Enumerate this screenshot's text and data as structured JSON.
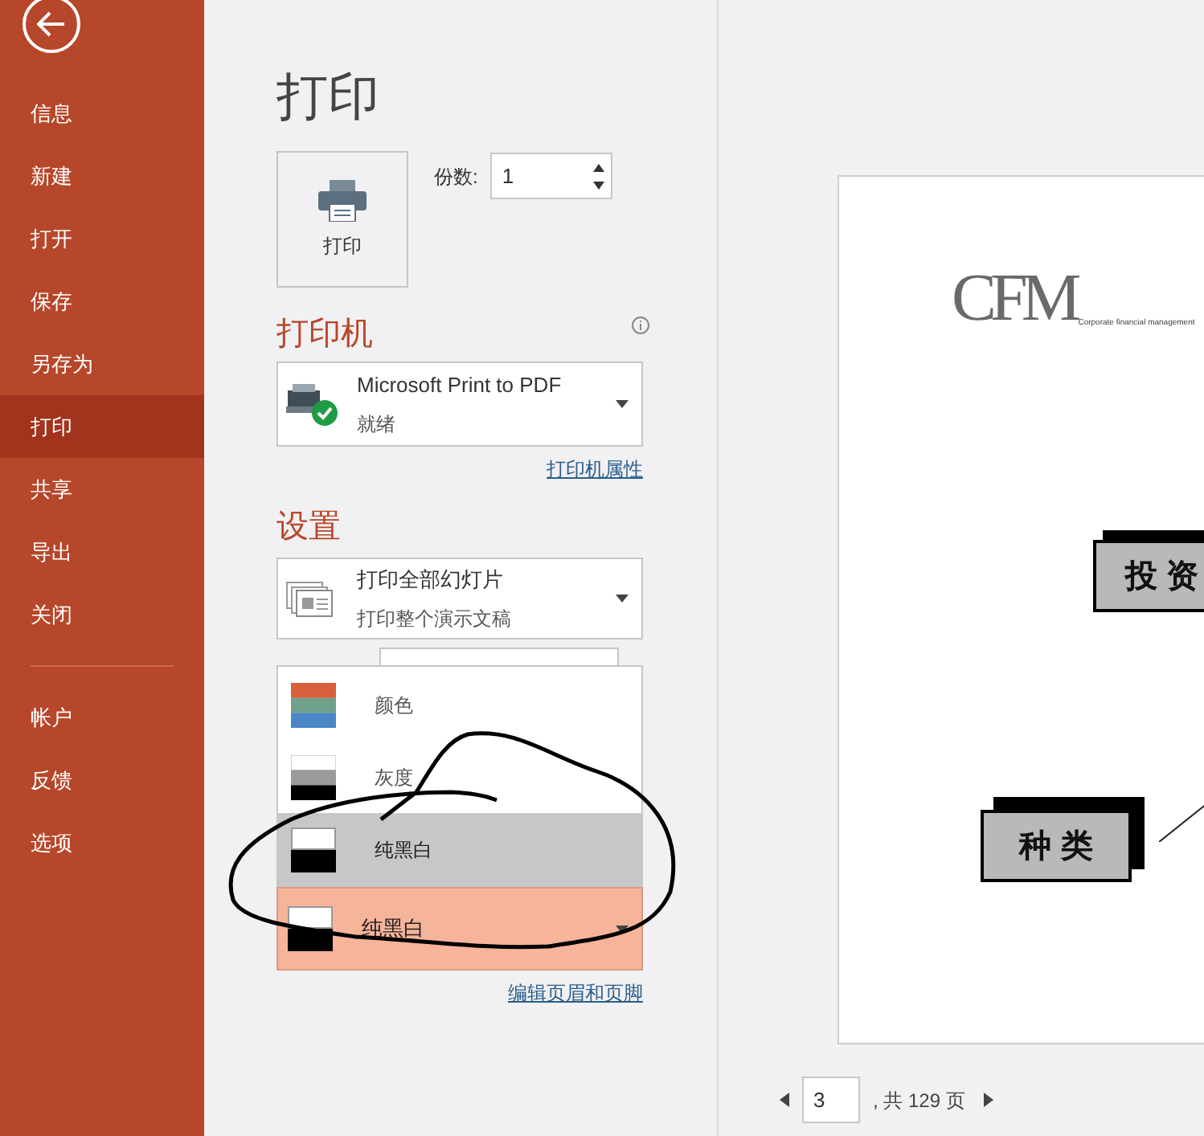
{
  "sidebar": {
    "items": [
      {
        "label": "信息",
        "selected": false
      },
      {
        "label": "新建",
        "selected": false
      },
      {
        "label": "打开",
        "selected": false
      },
      {
        "label": "保存",
        "selected": false
      },
      {
        "label": "另存为",
        "selected": false
      },
      {
        "label": "打印",
        "selected": true
      },
      {
        "label": "共享",
        "selected": false
      },
      {
        "label": "导出",
        "selected": false
      },
      {
        "label": "关闭",
        "selected": false
      }
    ],
    "bottom_items": [
      {
        "label": "帐户",
        "selected": false
      },
      {
        "label": "反馈",
        "selected": false
      },
      {
        "label": "选项",
        "selected": false
      }
    ]
  },
  "title": "打印",
  "print_button": {
    "label": "打印"
  },
  "copies": {
    "label": "份数:",
    "value": "1"
  },
  "printer": {
    "heading": "打印机",
    "name": "Microsoft Print to PDF",
    "status": "就绪",
    "link": "打印机属性"
  },
  "settings": {
    "heading": "设置",
    "slides": {
      "title": "打印全部幻灯片",
      "subtitle": "打印整个演示文稿"
    },
    "color_menu": [
      {
        "kind": "color",
        "label": "颜色",
        "selected": false
      },
      {
        "kind": "grayscale",
        "label": "灰度",
        "selected": false
      },
      {
        "kind": "blackwhite",
        "label": "纯黑白",
        "selected": true
      }
    ],
    "color": {
      "kind": "blackwhite",
      "label": "纯黑白"
    },
    "link": "编辑页眉和页脚"
  },
  "preview": {
    "logo": "CFM",
    "tagline": "Corporate financial management",
    "boxes": [
      "投 资",
      "种 类"
    ]
  },
  "pager": {
    "page": "3",
    "total": ", 共 129 页"
  }
}
